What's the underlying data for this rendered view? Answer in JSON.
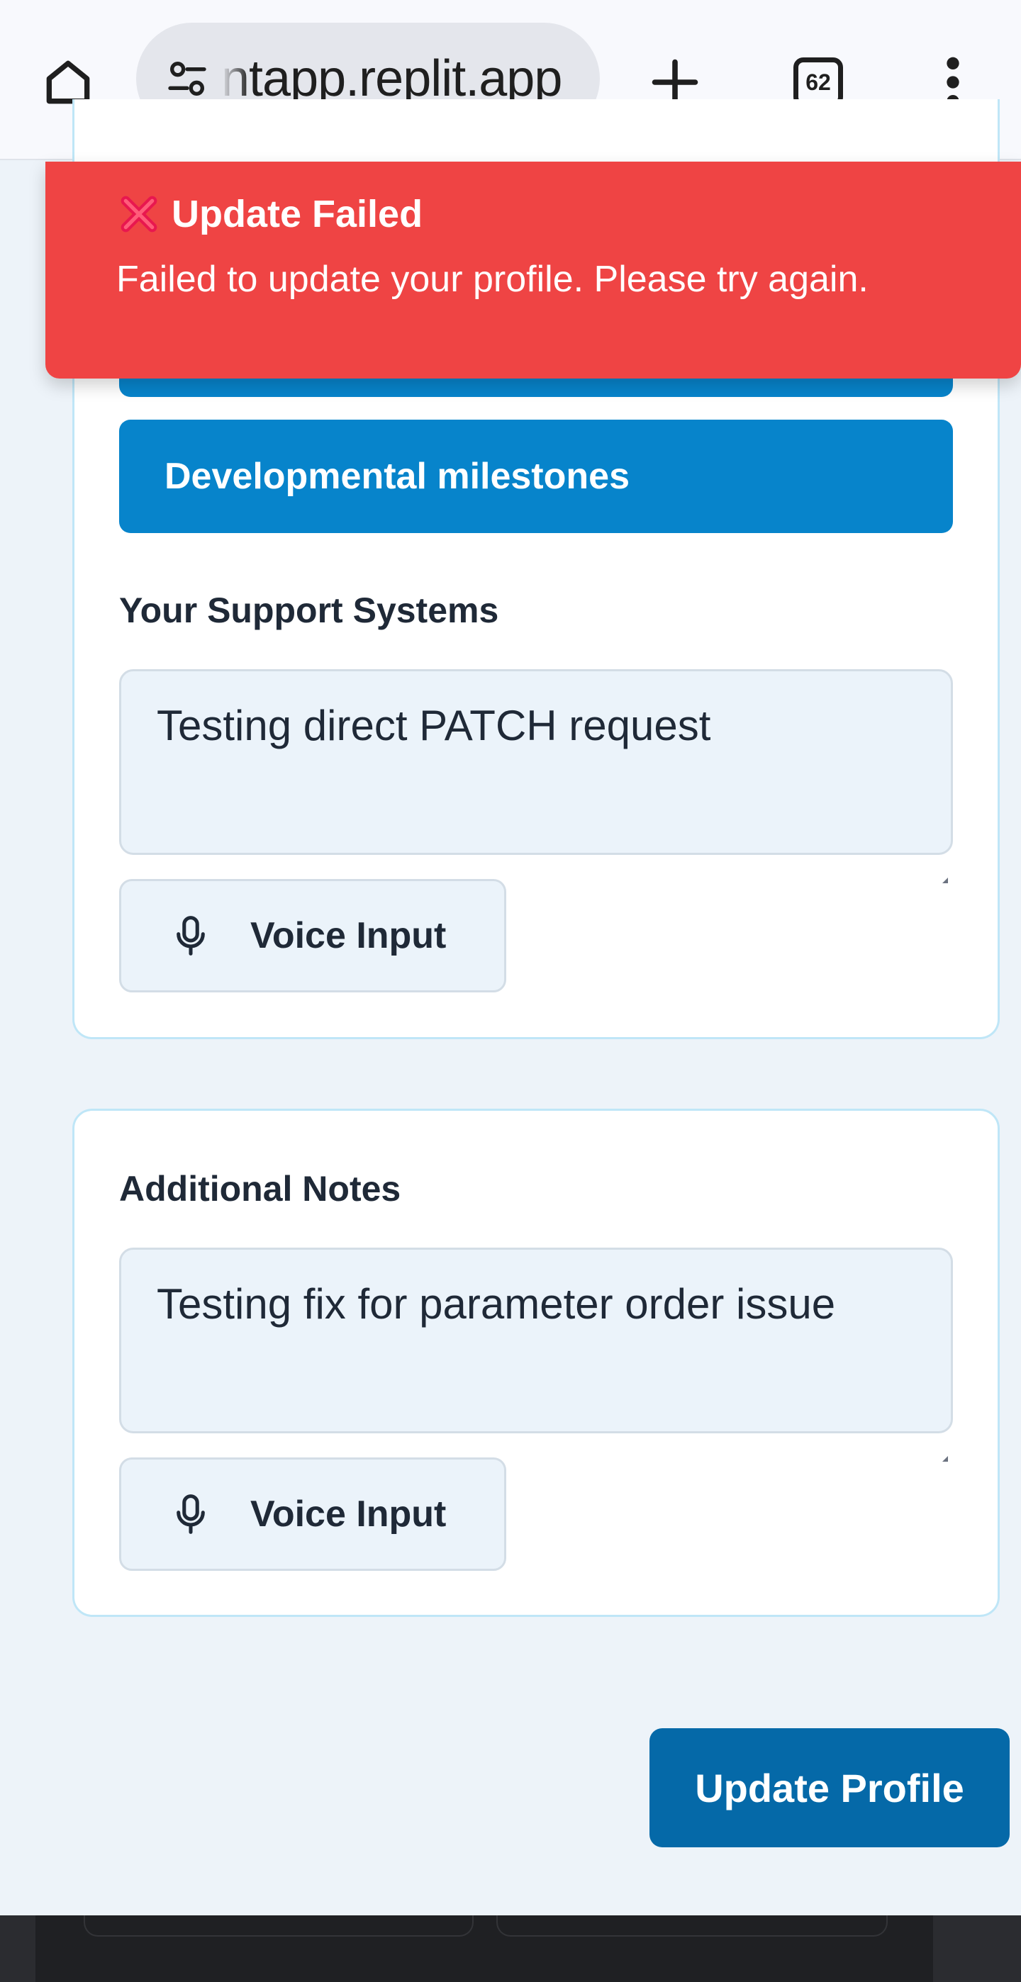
{
  "browser": {
    "url": "ntapp.replit.app",
    "tab_count": "62"
  },
  "toast": {
    "title": "Update Failed",
    "message": "Failed to update your profile. Please try again.",
    "color": "#ef4444"
  },
  "form": {
    "milestone_button": "Developmental milestones",
    "support": {
      "label": "Your Support Systems",
      "value": "Testing direct PATCH request",
      "voice_label": "Voice Input"
    },
    "notes": {
      "label": "Additional Notes",
      "value": "Testing fix for parameter order issue",
      "voice_label": "Voice Input"
    },
    "submit_label": "Update Profile"
  },
  "colors": {
    "accent": "#0784cb",
    "submit": "#0569a8",
    "page_bg": "#edf3f9"
  }
}
